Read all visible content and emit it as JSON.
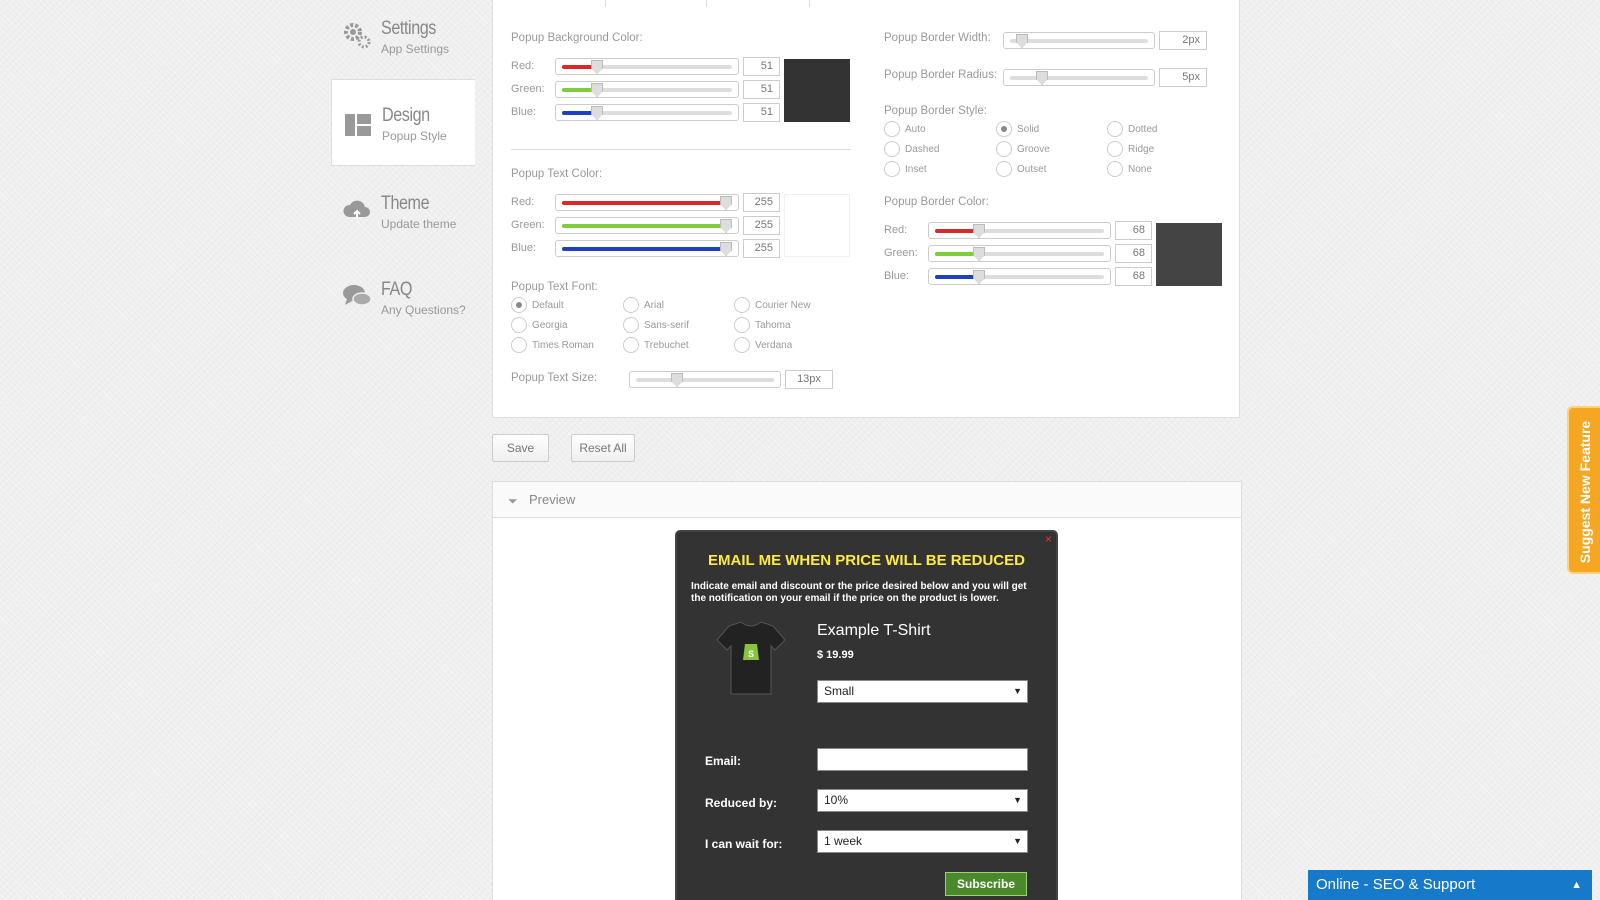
{
  "sidebar": {
    "items": [
      {
        "title": "Settings",
        "subtitle": "App Settings",
        "icon": "gear-icon"
      },
      {
        "title": "Design",
        "subtitle": "Popup Style",
        "icon": "layout-icon"
      },
      {
        "title": "Theme",
        "subtitle": "Update theme",
        "icon": "cloud-upload-icon"
      },
      {
        "title": "FAQ",
        "subtitle": "Any Questions?",
        "icon": "chat-bubbles-icon"
      }
    ]
  },
  "bg_color": {
    "label": "Popup Background Color:",
    "red_label": "Red:",
    "green_label": "Green:",
    "blue_label": "Blue:",
    "red": "51",
    "green": "51",
    "blue": "51",
    "swatch": "#333333"
  },
  "text_color": {
    "label": "Popup Text Color:",
    "red_label": "Red:",
    "green_label": "Green:",
    "blue_label": "Blue:",
    "red": "255",
    "green": "255",
    "blue": "255",
    "swatch": "#ffffff"
  },
  "text_font": {
    "label": "Popup Text Font:",
    "options": [
      "Default",
      "Arial",
      "Courier New",
      "Georgia",
      "Sans-serif",
      "Tahoma",
      "Times Roman",
      "Trebuchet",
      "Verdana"
    ],
    "selected": "Default"
  },
  "text_size": {
    "label": "Popup Text Size:",
    "value": "13px",
    "level": 0.3
  },
  "border_width": {
    "label": "Popup Border Width:",
    "value": "2px",
    "level": 0.05
  },
  "border_radius": {
    "label": "Popup Border Radius:",
    "value": "5px",
    "level": 0.2
  },
  "border_style": {
    "label": "Popup Border Style:",
    "options": [
      "Auto",
      "Solid",
      "Dotted",
      "Dashed",
      "Groove",
      "Ridge",
      "Inset",
      "Outset",
      "None"
    ],
    "selected": "Solid"
  },
  "border_color": {
    "label": "Popup Border Color:",
    "red_label": "Red:",
    "green_label": "Green:",
    "blue_label": "Blue:",
    "red": "68",
    "green": "68",
    "blue": "68",
    "swatch": "#444444"
  },
  "actions": {
    "save": "Save",
    "reset": "Reset All"
  },
  "preview": {
    "title": "Preview",
    "popup": {
      "close": "×",
      "heading": "EMAIL ME WHEN PRICE WILL BE REDUCED",
      "description": "Indicate email and discount or the price desired below and you will get the notification on your email if the price on the product is lower.",
      "product_name": "Example T-Shirt",
      "price": "$ 19.99",
      "variant": "Small",
      "email_label": "Email:",
      "email_value": "",
      "reduced_label": "Reduced by:",
      "reduced_value": "10%",
      "wait_label": "I can wait for:",
      "wait_value": "1 week",
      "subscribe": "Subscribe",
      "heading_color": "#ffea3d"
    }
  },
  "feature_tab": "Suggest New Feature",
  "support_bar": "Online - SEO & Support",
  "colors": {
    "red": "#d62a2a",
    "green": "#7ccc3c",
    "blue": "#1f3fbf",
    "accent": "#f5a623",
    "support": "#1779c9"
  }
}
